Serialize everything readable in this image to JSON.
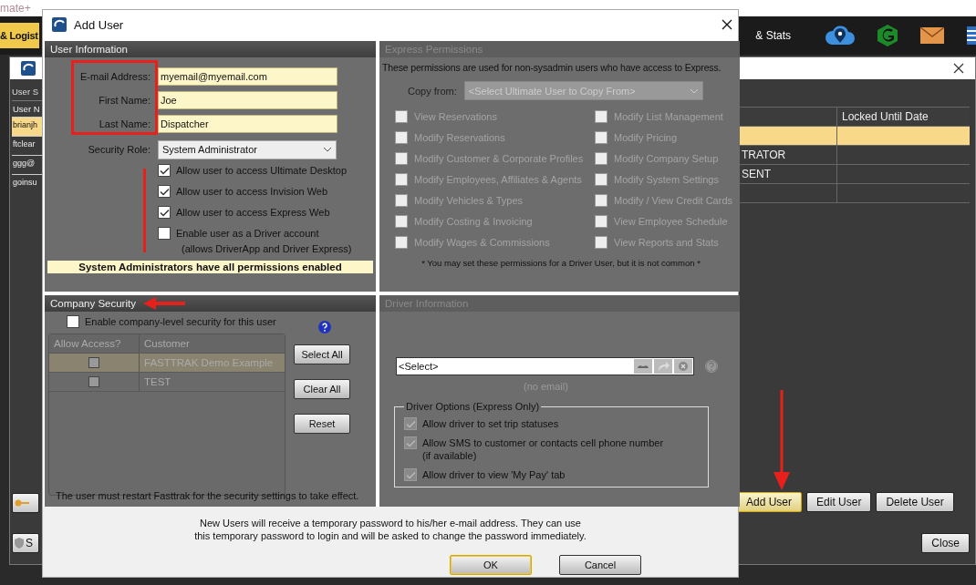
{
  "app": {
    "title_fragment": "mate+",
    "tabs": [
      {
        "label": "& Logist",
        "selected": true
      },
      {
        "label": "& Stats",
        "selected": false
      }
    ]
  },
  "users_window": {
    "section_fragment": "User S",
    "columns": [
      "User N",
      "",
      "Locked Until Date"
    ],
    "rows": [
      {
        "user": "brianjh",
        "role": "",
        "locked": "",
        "selected": true
      },
      {
        "user": "ftclear",
        "role": "TRATOR",
        "locked": "",
        "selected": false
      },
      {
        "user": "ggg@",
        "role": "SENT",
        "locked": "",
        "selected": false
      },
      {
        "user": "goinsu",
        "role": "",
        "locked": "",
        "selected": false
      }
    ],
    "buttons": [
      {
        "label": "Add User",
        "selected": true
      },
      {
        "label": "Edit User",
        "selected": false
      },
      {
        "label": "Delete User",
        "selected": false
      }
    ],
    "close": "Close",
    "left_button_fragment": "S"
  },
  "dialog": {
    "title": "Add User",
    "user_information": {
      "title": "User Information",
      "fields": [
        {
          "label": "E-mail Address:",
          "value": "myemail@myemail.com"
        },
        {
          "label": "First Name:",
          "value": "Joe"
        },
        {
          "label": "Last Name:",
          "value": "Dispatcher"
        }
      ],
      "security_role": {
        "label": "Security Role:",
        "value": "System Administrator"
      },
      "access": [
        {
          "label": "Allow user to access Ultimate Desktop",
          "checked": true
        },
        {
          "label": "Allow user to access Invision Web",
          "checked": true
        },
        {
          "label": "Allow user to access Express Web",
          "checked": true
        },
        {
          "label": "Enable user as a Driver account",
          "note": "(allows DriverApp and Driver Express)",
          "checked": false
        }
      ],
      "notice": "System Administrators have all permissions enabled"
    },
    "express_permissions": {
      "title": "Express Permissions",
      "description": "These permissions are used for non-sysadmin users who have access to Express.",
      "copy_from": {
        "label": "Copy from:",
        "value": "<Select Ultimate User to Copy From>"
      },
      "permissions": [
        {
          "label": "View Reservations",
          "checked": false
        },
        {
          "label": "Modify Reservations",
          "checked": false
        },
        {
          "label": "Modify Customer & Corporate Profiles",
          "checked": false
        },
        {
          "label": "Modify Employees, Affiliates & Agents",
          "checked": false
        },
        {
          "label": "Modify Vehicles & Types",
          "checked": false
        },
        {
          "label": "Modify Costing & Invoicing",
          "checked": false
        },
        {
          "label": "Modify Wages & Commissions",
          "checked": false
        },
        {
          "label": "Modify List Management",
          "checked": false
        },
        {
          "label": "Modify Pricing",
          "checked": false
        },
        {
          "label": "Modify Company Setup",
          "checked": false
        },
        {
          "label": "Modify System Settings",
          "checked": false
        },
        {
          "label": "Modify / View Credit Cards",
          "checked": false
        },
        {
          "label": "View Employee Schedule",
          "checked": false
        },
        {
          "label": "View Reports and Stats",
          "checked": false
        }
      ],
      "footnote": "* You may set these permissions for a Driver User, but it is not common *"
    },
    "company_security": {
      "title": "Company Security",
      "enable": {
        "label": "Enable company-level security for this user",
        "checked": false
      },
      "columns": [
        "Allow Access?",
        "Customer"
      ],
      "rows": [
        {
          "allowed": false,
          "customer": "FASTTRAK Demo Example",
          "selected": true
        },
        {
          "allowed": false,
          "customer": "TEST",
          "selected": false
        }
      ],
      "buttons": [
        "Select All",
        "Clear All",
        "Reset"
      ],
      "note": "The user must restart Fasttrak for the security settings to take effect."
    },
    "driver_information": {
      "title": "Driver Information",
      "driver_select": {
        "value": "<Select>"
      },
      "email": "(no email)",
      "options_title": "Driver Options (Express Only)",
      "options": [
        {
          "label": "Allow driver to set trip statuses",
          "checked": true
        },
        {
          "label": "Allow SMS to customer or contacts cell phone number",
          "note": "(if available)",
          "checked": true
        },
        {
          "label": "Allow driver to view 'My Pay' tab",
          "checked": true
        }
      ]
    },
    "footer_message": "New Users will receive a temporary password to his/her e-mail address. They can use this temporary password to login and will be asked to change the password immediately.",
    "buttons": [
      {
        "label": "OK",
        "default": true
      },
      {
        "label": "Cancel",
        "default": false
      }
    ]
  }
}
